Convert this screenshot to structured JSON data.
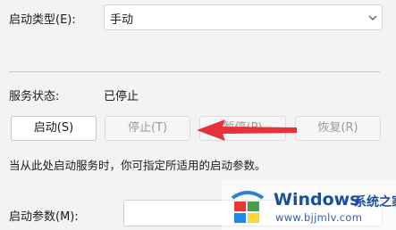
{
  "startup": {
    "label": "启动类型(E):",
    "value": "手动"
  },
  "service_status": {
    "label": "服务状态:",
    "value": "已停止"
  },
  "buttons": {
    "start": "启动(S)",
    "stop": "停止(T)",
    "pause": "暂停(P)",
    "resume": "恢复(R)"
  },
  "hint": "当从此处启动服务时，你可指定所适用的启动参数。",
  "params": {
    "label": "启动参数(M):",
    "value": ""
  },
  "annotation": {
    "arrow_color": "#e8323a",
    "arrow_icon": "red-arrow-left"
  },
  "watermark": {
    "brand": "Windows",
    "brand_cn": "系统之家",
    "url": "www.bjjmlv.com"
  }
}
